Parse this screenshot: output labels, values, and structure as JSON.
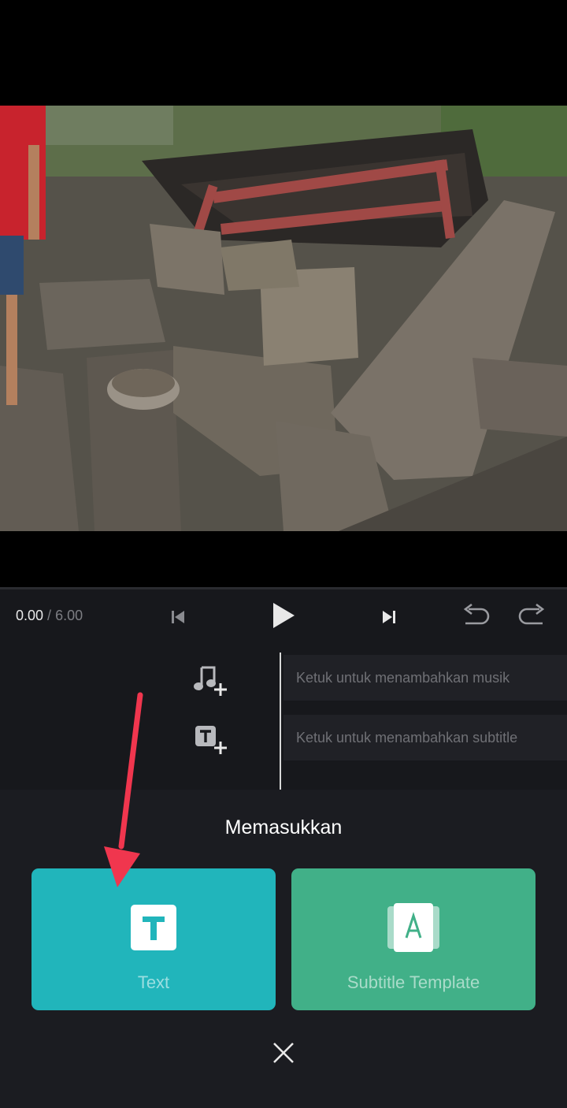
{
  "player": {
    "current_time": "0.00",
    "separator": " / ",
    "total_time": "6.00"
  },
  "controls": {
    "prev_icon": "skip-previous-icon",
    "play_icon": "play-icon",
    "next_icon": "skip-next-icon",
    "undo_icon": "undo-icon",
    "redo_icon": "redo-icon"
  },
  "tracks": {
    "music_placeholder": "Ketuk untuk menambahkan musik",
    "subtitle_placeholder": "Ketuk untuk menambahkan subtitle"
  },
  "sheet": {
    "title": "Memasukkan",
    "options": [
      {
        "label": "Text",
        "icon": "text-icon",
        "color": "#21b5bb"
      },
      {
        "label": "Subtitle Template",
        "icon": "subtitle-template-icon",
        "color": "#41b088"
      }
    ],
    "close_icon": "close-icon"
  },
  "colors": {
    "annotation_arrow": "#f0364e",
    "background": "#17181c"
  }
}
